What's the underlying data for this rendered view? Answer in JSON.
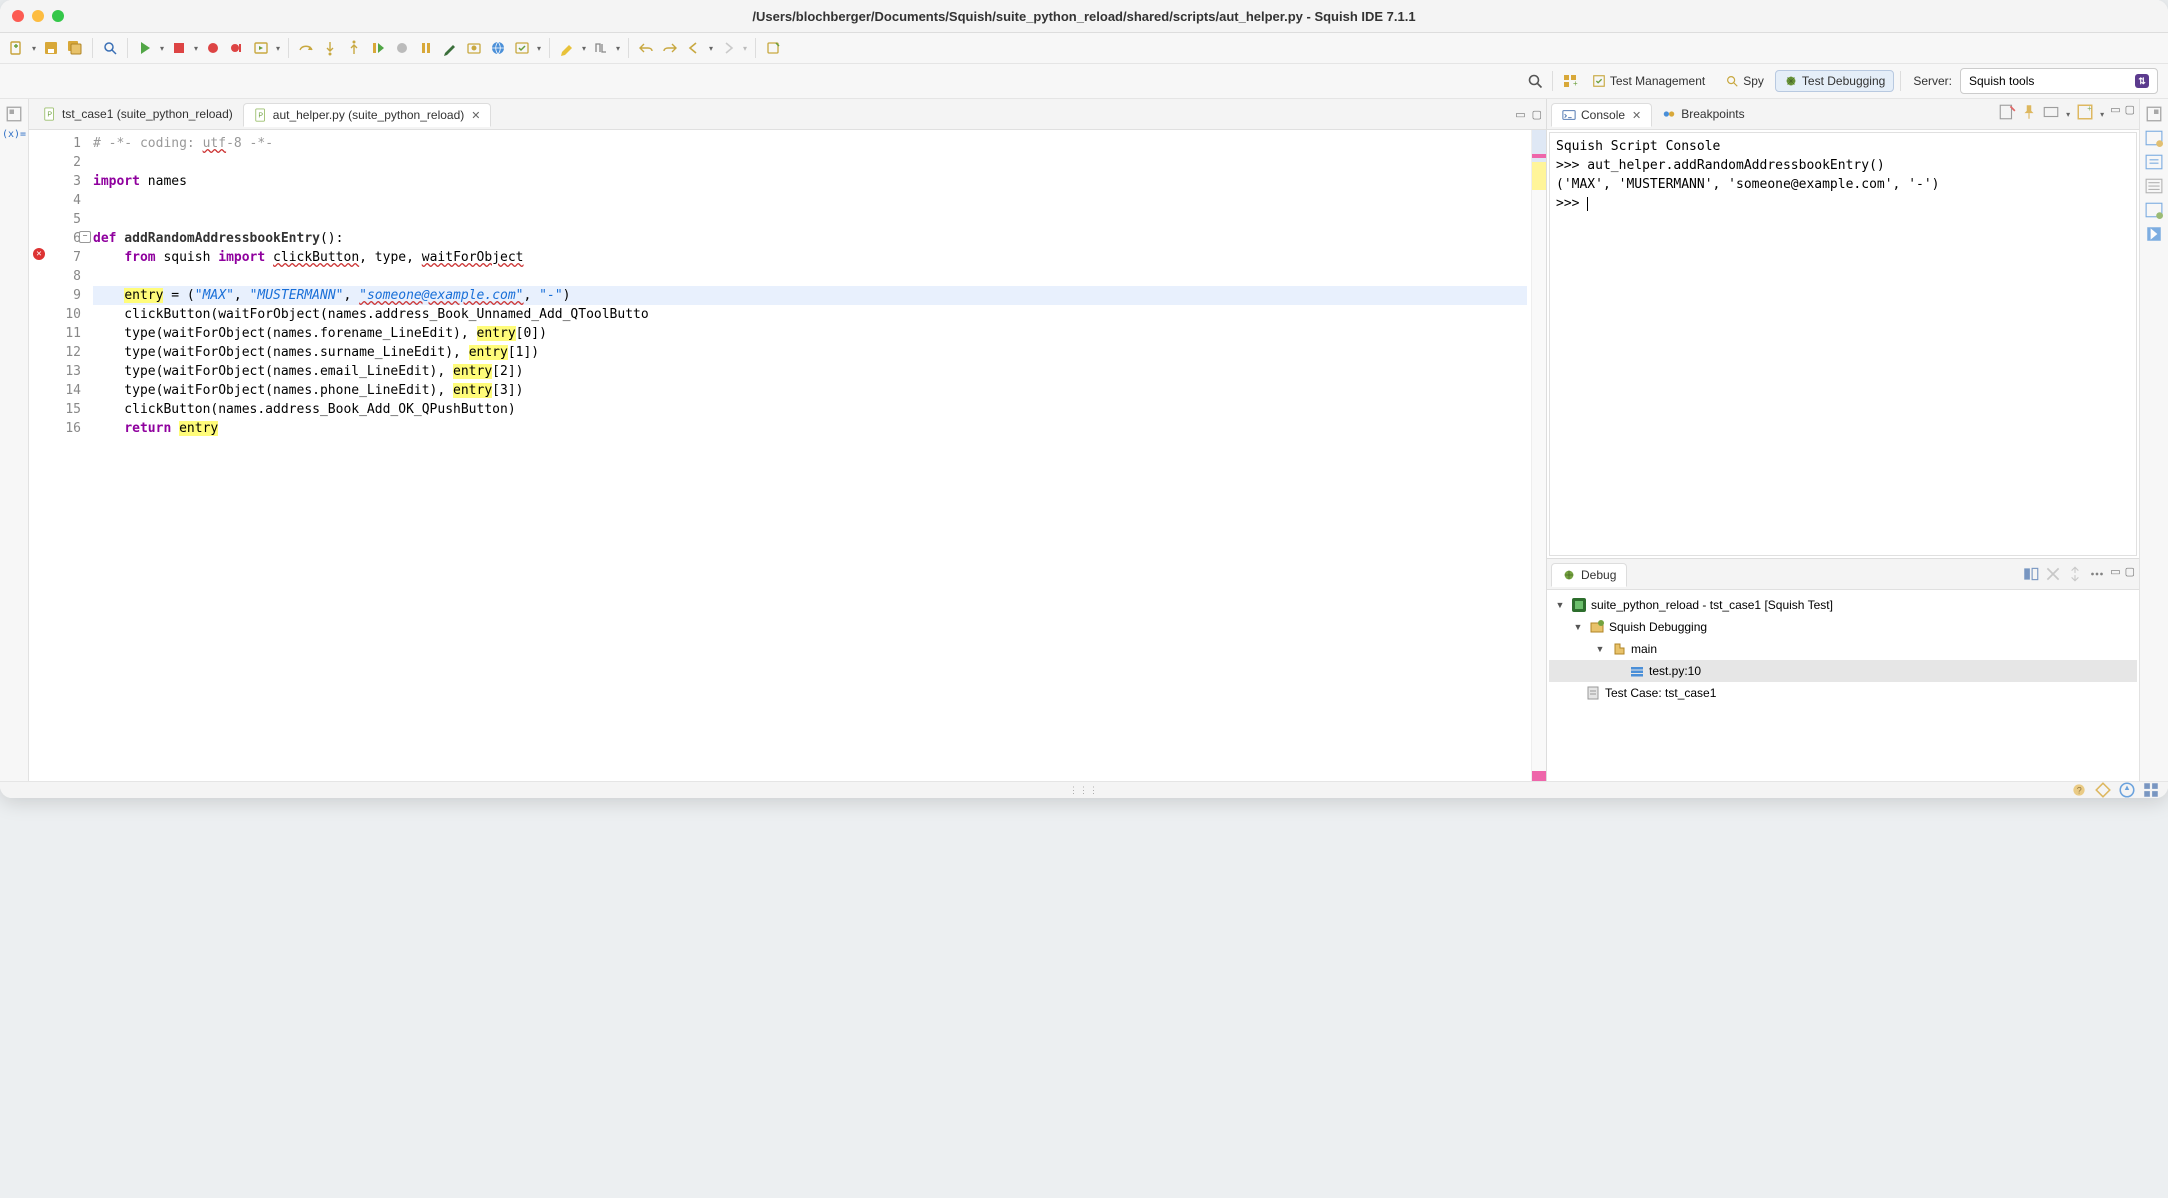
{
  "window": {
    "title": "/Users/blochberger/Documents/Squish/suite_python_reload/shared/scripts/aut_helper.py - Squish IDE 7.1.1"
  },
  "perspectives": {
    "test_management": "Test Management",
    "spy": "Spy",
    "test_debugging": "Test Debugging",
    "server_label": "Server:",
    "server_value": "Squish tools"
  },
  "left_sidebar": {
    "variables_label": "(x)="
  },
  "editor": {
    "tabs": [
      {
        "label": "tst_case1 (suite_python_reload)",
        "active": false,
        "closable": false
      },
      {
        "label": "aut_helper.py (suite_python_reload)",
        "active": true,
        "closable": true
      }
    ],
    "lines": [
      "1",
      "2",
      "3",
      "4",
      "5",
      "6",
      "7",
      "8",
      "9",
      "10",
      "11",
      "12",
      "13",
      "14",
      "15",
      "16"
    ],
    "error_line": 7,
    "fold_line": 6,
    "highlight_line": 9,
    "code": {
      "l1": "# -*- coding: utf-8 -*-",
      "l1_under": "utf",
      "l3_kw": "import",
      "l3_rest": " names",
      "l6_kw": "def",
      "l6_fn": " addRandomAddressbookEntry",
      "l6_rest": "():",
      "l7_kw1": "from",
      "l7_m": " squish ",
      "l7_kw2": "import",
      "l7_rest": " ",
      "l7_e1": "clickButton",
      "l7_c": ", type, ",
      "l7_e2": "waitForObject",
      "l9_a": "entry",
      "l9_b": " = (",
      "l9_s1": "\"MAX\"",
      "l9_c": ", ",
      "l9_s2": "\"MUSTERMANN\"",
      "l9_d": ", ",
      "l9_s3": "\"someone@example.com\"",
      "l9_e": ", ",
      "l9_s4": "\"-\"",
      "l9_f": ")",
      "l10": "    clickButton(waitForObject(names.address_Book_Unnamed_Add_QToolButto",
      "l11a": "    type(waitForObject(names.forename_LineEdit), ",
      "l11b": "entry",
      "l11c": "[0])",
      "l12a": "    type(waitForObject(names.surname_LineEdit), ",
      "l12b": "entry",
      "l12c": "[1])",
      "l13a": "    type(waitForObject(names.email_LineEdit), ",
      "l13b": "entry",
      "l13c": "[2])",
      "l14a": "    type(waitForObject(names.phone_LineEdit), ",
      "l14b": "entry",
      "l14c": "[3])",
      "l15": "    clickButton(names.address_Book_Add_OK_QPushButton)",
      "l16_kw": "return",
      "l16_sp": " ",
      "l16_hl": "entry"
    }
  },
  "console": {
    "tab_console": "Console",
    "tab_breakpoints": "Breakpoints",
    "header": "Squish Script Console",
    "line1": ">>> aut_helper.addRandomAddressbookEntry()",
    "line2": "('MAX', 'MUSTERMANN', 'someone@example.com', '-')",
    "line3": ">>> "
  },
  "debug": {
    "tab_label": "Debug",
    "tree": {
      "root": "suite_python_reload - tst_case1 [Squish Test]",
      "n1": "Squish Debugging",
      "n2": "main",
      "n3": "test.py:10",
      "n4": "Test Case: tst_case1"
    }
  }
}
